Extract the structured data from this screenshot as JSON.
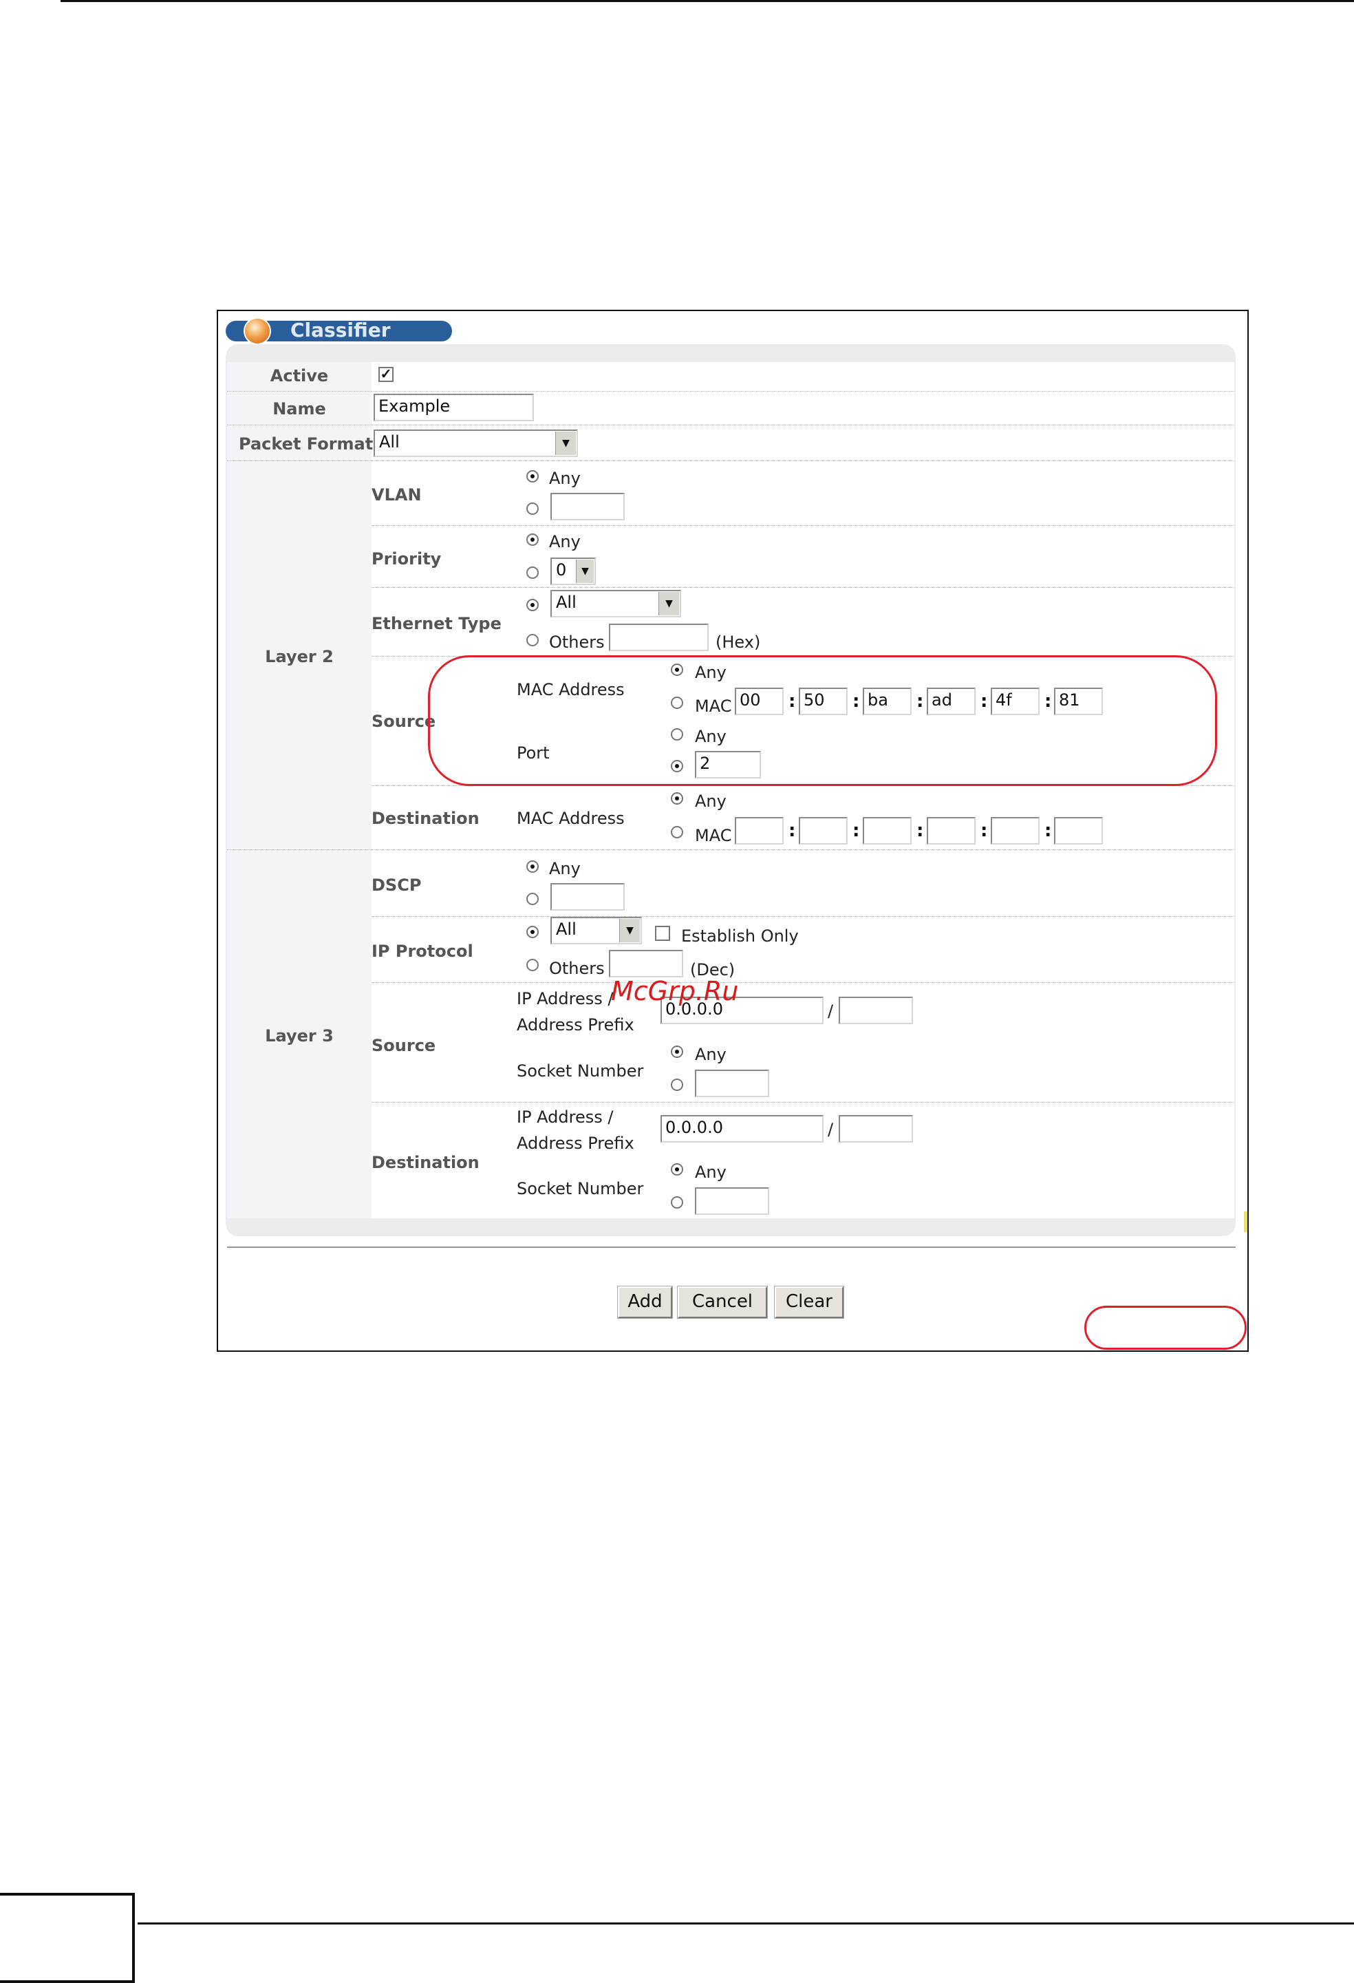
{
  "header": {
    "title": "Classifier"
  },
  "active": {
    "label": "Active",
    "checked": true
  },
  "name": {
    "label": "Name",
    "value": "Example"
  },
  "packet_format": {
    "label": "Packet Format",
    "value": "All"
  },
  "layer2": {
    "label": "Layer 2",
    "vlan": {
      "label": "VLAN",
      "any": "Any",
      "value": ""
    },
    "priority": {
      "label": "Priority",
      "any": "Any",
      "value": "0"
    },
    "ethernet_type": {
      "label": "Ethernet Type",
      "value": "All",
      "others": "Others",
      "others_value": "",
      "unit": "(Hex)"
    },
    "source": {
      "label": "Source",
      "mac_label": "MAC Address",
      "any": "Any",
      "mac": "MAC",
      "mac_octets": [
        "00",
        "50",
        "ba",
        "ad",
        "4f",
        "81"
      ],
      "port_label": "Port",
      "port_any": "Any",
      "port_value": "2"
    },
    "destination": {
      "label": "Destination",
      "mac_label": "MAC Address",
      "any": "Any",
      "mac": "MAC",
      "mac_octets": [
        "",
        "",
        "",
        "",
        "",
        ""
      ]
    }
  },
  "layer3": {
    "label": "Layer 3",
    "dscp": {
      "label": "DSCP",
      "any": "Any",
      "value": ""
    },
    "ip_protocol": {
      "label": "IP Protocol",
      "value": "All",
      "establish_only": "Establish Only",
      "others": "Others",
      "others_value": "",
      "unit": "(Dec)"
    },
    "source": {
      "label": "Source",
      "ip_label_1": "IP Address /",
      "ip_label_2": "Address Prefix",
      "ip_value": "0.0.0.0",
      "slash": "/",
      "prefix_value": "",
      "socket_label": "Socket Number",
      "socket_any": "Any",
      "socket_value": ""
    },
    "destination": {
      "label": "Destination",
      "ip_label_1": "IP Address /",
      "ip_label_2": "Address Prefix",
      "ip_value": "0.0.0.0",
      "slash": "/",
      "prefix_value": "",
      "socket_label": "Socket Number",
      "socket_any": "Any",
      "socket_value": ""
    }
  },
  "buttons": {
    "add": "Add",
    "cancel": "Cancel",
    "clear": "Clear"
  },
  "watermark": "McGrp.Ru",
  "colors": {
    "header_pill": "#2a5e9b",
    "highlight": "#e0202a",
    "label_text": "#555555"
  }
}
